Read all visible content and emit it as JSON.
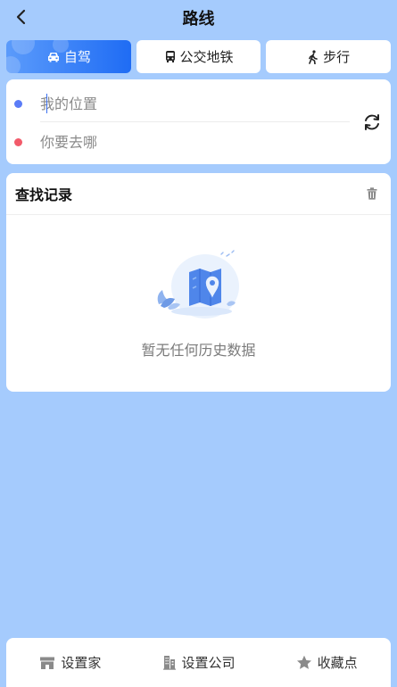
{
  "header": {
    "title": "路线"
  },
  "tabs": [
    {
      "label": "自驾",
      "icon": "car-icon",
      "active": true
    },
    {
      "label": "公交地铁",
      "icon": "bus-icon",
      "active": false
    },
    {
      "label": "步行",
      "icon": "walk-icon",
      "active": false
    }
  ],
  "route": {
    "from_placeholder": "我的位置",
    "to_placeholder": "你要去哪",
    "from_dot_color": "#5b7cf7",
    "to_dot_color": "#f25a6a"
  },
  "history": {
    "title": "查找记录",
    "empty_text": "暂无任何历史数据"
  },
  "bottom_bar": [
    {
      "label": "设置家",
      "icon": "home-icon"
    },
    {
      "label": "设置公司",
      "icon": "building-icon"
    },
    {
      "label": "收藏点",
      "icon": "star-icon"
    }
  ],
  "colors": {
    "background": "#a5cbfd",
    "accent": "#1f6cf4",
    "icon_gray": "#8a8a8a"
  }
}
